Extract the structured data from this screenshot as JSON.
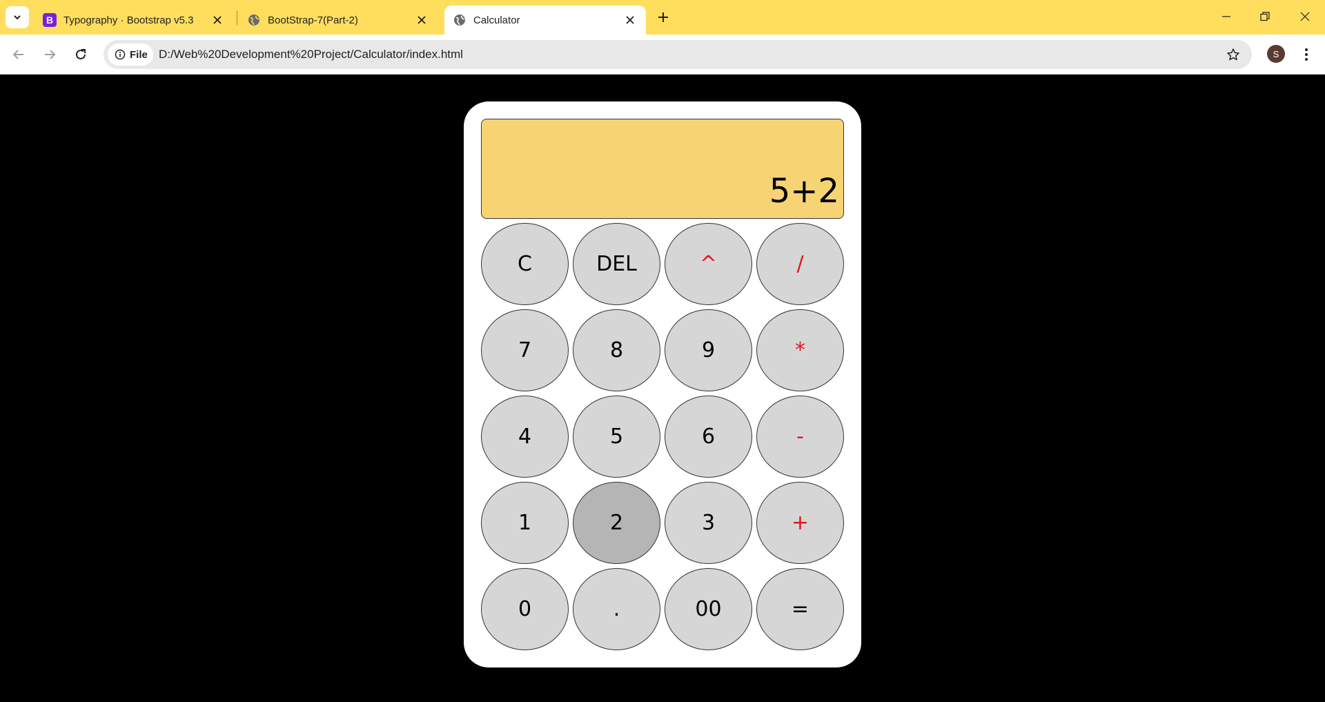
{
  "browser": {
    "tabs": [
      {
        "title": "Typography · Bootstrap v5.3",
        "favicon": "bootstrap-icon",
        "active": false
      },
      {
        "title": "BootStrap-7(Part-2)",
        "favicon": "globe-icon",
        "active": false
      },
      {
        "title": "Calculator",
        "favicon": "globe-icon",
        "active": true
      }
    ],
    "address": {
      "chip_label": "File",
      "url": "D:/Web%20Development%20Project/Calculator/index.html"
    },
    "profile_initial": "S"
  },
  "calculator": {
    "display": "5+2",
    "keys": [
      [
        "C",
        "DEL",
        "^",
        "/"
      ],
      [
        "7",
        "8",
        "9",
        "*"
      ],
      [
        "4",
        "5",
        "6",
        "-"
      ],
      [
        "1",
        "2",
        "3",
        "+"
      ],
      [
        "0",
        ".",
        "00",
        "="
      ]
    ],
    "pressed_key": "2"
  },
  "colors": {
    "tabbar_bg": "#ffde5e",
    "display_bg": "#f7d473",
    "key_bg": "#d6d6d6",
    "key_pressed_bg": "#b5b5b5",
    "operator_text": "#e8141b",
    "page_bg": "#000000"
  }
}
